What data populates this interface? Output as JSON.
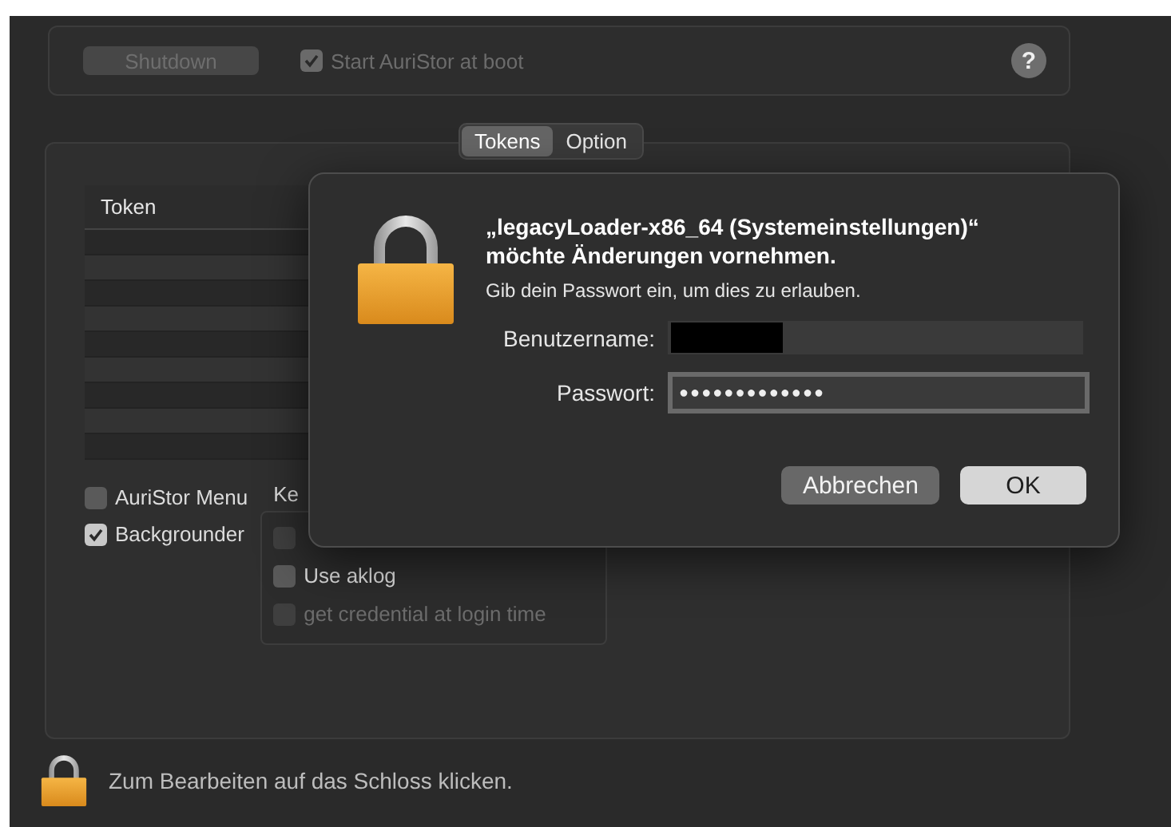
{
  "toolbar": {
    "shutdown_button": {
      "label": "Shutdown",
      "disabled": true
    },
    "start_at_boot": {
      "label": "Start AuriStor at boot",
      "checked": true,
      "disabled": true
    },
    "help_button": "?"
  },
  "tabs": [
    {
      "label": "Tokens",
      "selected": true
    },
    {
      "label": "Option",
      "selected": false
    }
  ],
  "token_table": {
    "columns": [
      "Token"
    ]
  },
  "options": [
    {
      "label": "AuriStor Menu",
      "checked": false
    },
    {
      "label": "Backgrounder",
      "checked": true
    }
  ],
  "keychain_group": {
    "title": "Ke",
    "items": [
      {
        "checked": false,
        "disabled": true
      },
      {
        "label": "Use aklog",
        "checked": false,
        "disabled": false
      },
      {
        "label": "get credential at login time",
        "checked": false,
        "disabled": true
      }
    ]
  },
  "dialog": {
    "title": "„legacyLoader-x86_64 (Systemeinstellungen)“ möchte Änderungen vornehmen.",
    "message": "Gib dein Passwort ein, um dies zu erlauben.",
    "username": {
      "label": "Benutzername:",
      "redacted": true
    },
    "password": {
      "label": "Passwort:",
      "value": "●●●●●●●●●●●●●",
      "focused": true
    },
    "buttons": [
      {
        "label": "Abbrechen",
        "default": false
      },
      {
        "label": "OK",
        "default": true
      }
    ]
  },
  "status": {
    "text": "Zum Bearbeiten auf das Schloss klicken."
  }
}
